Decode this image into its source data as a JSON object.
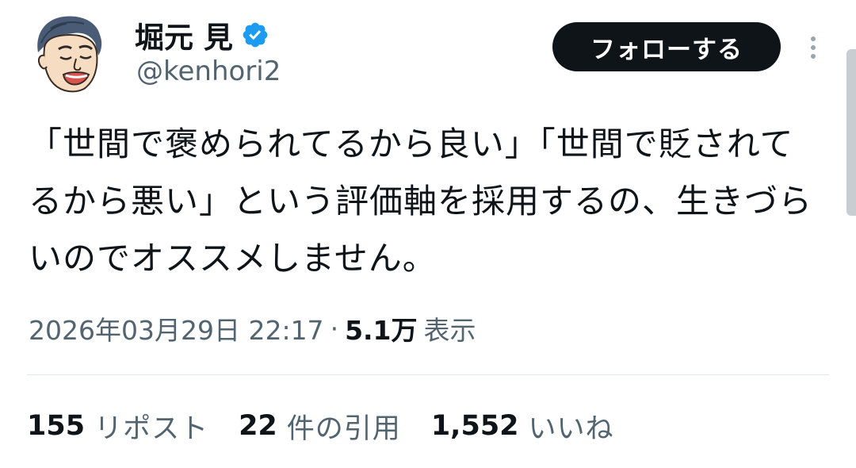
{
  "author": {
    "display_name": "堀元 見",
    "handle": "@kenhori2",
    "avatar_icon": "caricature-avatar-icon",
    "verified_icon": "verified-badge-icon",
    "verified_color": "#1d9bf0"
  },
  "follow_button": {
    "label": "フォローする"
  },
  "more_button": {
    "icon": "more-vertical-icon"
  },
  "tweet": {
    "text": "「世間で褒められてるから良い」「世間で貶されてるから悪い」という評価軸を採用するの、生きづらいのでオススメしません。",
    "timestamp": "2026年03月29日 22:17",
    "separator": "·",
    "views_count": "5.1万",
    "views_label": "表示"
  },
  "stats": [
    {
      "count": "155",
      "label": "リポスト"
    },
    {
      "count": "22",
      "label": "件の引用"
    },
    {
      "count": "1,552",
      "label": "いいね"
    }
  ],
  "colors": {
    "text_primary": "#0f1419",
    "text_secondary": "#536471",
    "button_bg": "#0f1419",
    "divider": "#e1e6ea"
  }
}
